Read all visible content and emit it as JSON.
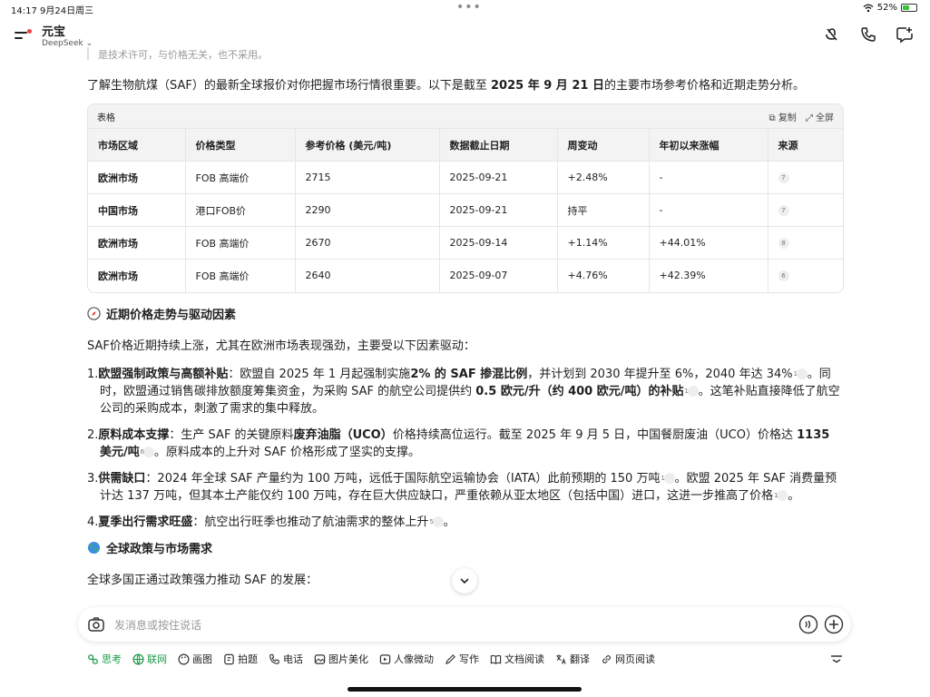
{
  "status_bar": {
    "time": "14:17  9月24日周三",
    "battery": "52%",
    "battery_level": 0.52
  },
  "header": {
    "title": "元宝",
    "subtitle": "DeepSeek"
  },
  "content": {
    "truncated_line": "是技术许可，与价格无关，也不采用。",
    "intro_before": "了解生物航煤（SAF）的最新全球报价对你把握市场行情很重要。以下是截至 ",
    "intro_bold": "2025 年 9 月 21 日",
    "intro_after": "的主要市场参考价格和近期走势分析。",
    "table": {
      "label": "表格",
      "copy": "复制",
      "fullscreen": "全屏",
      "headers": [
        "市场区域",
        "价格类型",
        "参考价格 (美元/吨)",
        "数据截止日期",
        "周变动",
        "年初以来涨幅",
        "来源"
      ],
      "rows": [
        [
          "欧洲市场",
          "FOB 高端价",
          "2715",
          "2025-09-21",
          "+2.48%",
          "-",
          "7"
        ],
        [
          "中国市场",
          "港口FOB价",
          "2290",
          "2025-09-21",
          "持平",
          "-",
          "7"
        ],
        [
          "欧洲市场",
          "FOB 高端价",
          "2670",
          "2025-09-14",
          "+1.14%",
          "+44.01%",
          "8"
        ],
        [
          "欧洲市场",
          "FOB 高端价",
          "2640",
          "2025-09-07",
          "+4.76%",
          "+42.39%",
          "6"
        ]
      ]
    },
    "section1_title": "近期价格走势与驱动因素",
    "section1_intro": "SAF价格近期持续上涨，尤其在欧洲市场表现强劲，主要受以下因素驱动：",
    "items": [
      {
        "num": "1.",
        "title": "欧盟强制政策与高额补贴",
        "t1": "：欧盟自 2025 年 1 月起强制实施",
        "b1": "2% 的 SAF 掺混比例",
        "t2": "，并计划到 2030 年提升至 6%，2040 年达 34%",
        "c1": "1",
        "t3": "。同时，欧盟通过销售碳排放额度筹集资金，为采购 SAF 的航空公司提供约 ",
        "b2": "0.5 欧元/升（约 400 欧元/吨）的补贴",
        "c2": "1",
        "t4": "。这笔补贴直接降低了航空公司的采购成本，刺激了需求的集中释放。"
      },
      {
        "num": "2.",
        "title": "原料成本支撑",
        "t1": "：生产 SAF 的关键原料",
        "b1": "废弃油脂（UCO）",
        "t2": "价格持续高位运行。截至 2025 年 9 月 5 日，中国餐厨废油（UCO）价格达 ",
        "b2": "1135 美元/吨",
        "c1": "6",
        "t3": "。原料成本的上升对 SAF 价格形成了坚实的支撑。"
      },
      {
        "num": "3.",
        "title": "供需缺口",
        "t1": "：2024 年全球 SAF 产量约为 100 万吨，远低于国际航空运输协会（IATA）此前预期的 150 万吨",
        "c1": "1",
        "t2": "。欧盟 2025 年 SAF 消费量预计达 137 万吨，但其本土产能仅约 100 万吨，存在巨大供应缺口，严重依赖从亚太地区（包括中国）进口，这进一步推高了价格",
        "c2": "1",
        "t3": "。"
      },
      {
        "num": "4.",
        "title": "夏季出行需求旺盛",
        "t1": "：航空出行旺季也推动了航油需求的整体上升",
        "c1": "5",
        "t2": "。"
      }
    ],
    "section2_title": "全球政策与市场需求",
    "section2_intro": "全球多国正通过政策强力推动 SAF 的发展："
  },
  "input": {
    "placeholder": "发消息或按住说话"
  },
  "toolbar": {
    "items": [
      {
        "label": "思考",
        "icon": "think-icon"
      },
      {
        "label": "联网",
        "icon": "globe-icon"
      },
      {
        "label": "画图",
        "icon": "palette-icon"
      },
      {
        "label": "拍题",
        "icon": "photo-question-icon"
      },
      {
        "label": "电话",
        "icon": "phone-icon"
      },
      {
        "label": "图片美化",
        "icon": "image-icon"
      },
      {
        "label": "人像微动",
        "icon": "portrait-motion-icon"
      },
      {
        "label": "写作",
        "icon": "pen-icon"
      },
      {
        "label": "文档阅读",
        "icon": "book-icon"
      },
      {
        "label": "翻译",
        "icon": "translate-icon"
      },
      {
        "label": "网页阅读",
        "icon": "link-icon"
      }
    ]
  },
  "colors": {
    "accent_green": "#1f9b4a",
    "text": "#1f1f1f",
    "table_header_bg": "#f3f3f3"
  }
}
